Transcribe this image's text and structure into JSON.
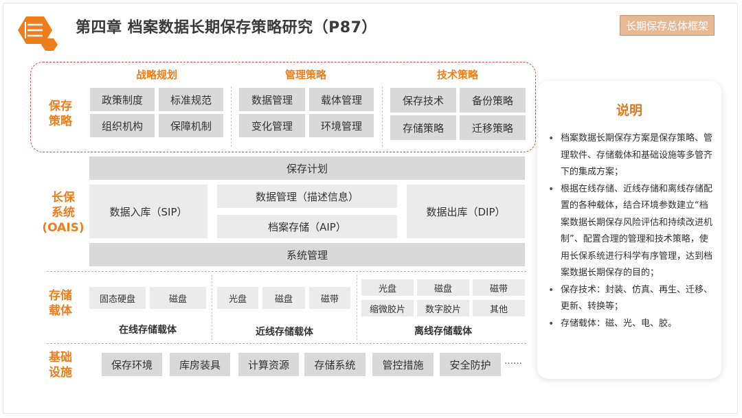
{
  "header": {
    "title": "第四章  档案数据长期保存策略研究（P87）",
    "tag": "长期保存总体框架"
  },
  "strategy": {
    "row_label": [
      "保存",
      "策略"
    ],
    "groups": [
      {
        "title": "战略规划",
        "items": [
          "政策制度",
          "标准规范",
          "组织机构",
          "保障机制"
        ]
      },
      {
        "title": "管理策略",
        "items": [
          "数据管理",
          "载体管理",
          "变化管理",
          "环境管理"
        ]
      },
      {
        "title": "技术策略",
        "items": [
          "保存技术",
          "备份策略",
          "存储策略",
          "迁移策略"
        ]
      }
    ]
  },
  "oais": {
    "row_label": [
      "长保",
      "系统",
      "(OAIS)"
    ],
    "plan": "保存计划",
    "ingest": "数据入库（SIP）",
    "data_management": "数据管理（描述信息）",
    "archival_storage": "档案存储（AIP）",
    "dissemination": "数据出库（DIP）",
    "system_management": "系统管理"
  },
  "storage": {
    "row_label": [
      "存储",
      "载体"
    ],
    "online": {
      "items": [
        "固态硬盘",
        "磁盘"
      ],
      "caption": "在线存储载体"
    },
    "nearline": {
      "items": [
        "光盘",
        "磁盘",
        "磁带"
      ],
      "caption": "近线存储载体"
    },
    "offline": {
      "items": [
        "光盘",
        "磁盘",
        "磁带",
        "缩微胶片",
        "数字胶片",
        "其他"
      ],
      "caption": "离线存储载体"
    }
  },
  "infrastructure": {
    "row_label": [
      "基础",
      "设施"
    ],
    "items": [
      "保存环境",
      "库房装具",
      "计算资源",
      "存储系统",
      "管控措施",
      "安全防护"
    ],
    "more": "……"
  },
  "explanation": {
    "title": "说明",
    "bullets": [
      "档案数据长期保存方案是保存策略、管理软件、存储载体和基础设施等多管齐下的集成方案；",
      "根据在线存储、近线存储和离线存储配置的各种载体，结合环境参数建立“档案数据长期保存风险评估和持续改进机制”、配置合理的管理和技术策略，使用长保系统进行科学有序管理，达到档案数据长期保存的目的；",
      "保存技术：封装、仿真、再生、迁移、更新、转换等；",
      "存储载体：磁、光、电、胶。"
    ]
  },
  "colors": {
    "accent": "#ee7d1c",
    "box": "#d9d9d9",
    "box_light": "#ebebeb",
    "strategy_border": "#e5463b",
    "tag_bg": "#e5b996"
  }
}
